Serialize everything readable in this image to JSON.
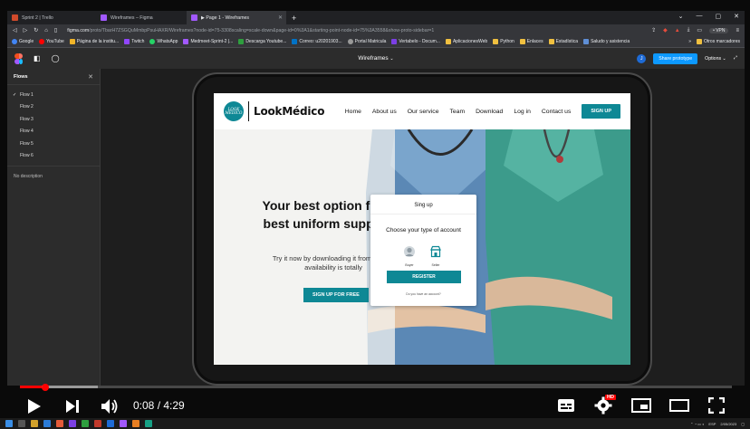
{
  "browser": {
    "tabs": [
      {
        "title": "Sprint 2 | Trello",
        "color": "#d04a2b"
      },
      {
        "title": "Wireframes – Figma",
        "color": "#a259ff"
      },
      {
        "title": "▶ Page 1 - Wireframes",
        "color": "#a259ff",
        "active": true
      }
    ],
    "url_host": "figma.com",
    "url_rest": "/proto/TbarH7ZSGQuMmbpPsuHAXR/Wireframes?node-id=75-3308scaling=scale-down&page-id=0%3A1&starting-point-node-id=75%3A3558&show-proto-sidebar=1",
    "vpn_label": "• VPN",
    "bookmarks": [
      {
        "label": "Google",
        "color": "#4285f4"
      },
      {
        "label": "YouTube",
        "color": "#ff0000"
      },
      {
        "label": "Página de la institu...",
        "color": "#f0b429"
      },
      {
        "label": "Twitch",
        "color": "#9146ff"
      },
      {
        "label": "WhatsApp",
        "color": "#25d366"
      },
      {
        "label": "Medmeet-Sprint-2 |...",
        "color": "#a259ff"
      },
      {
        "label": "Descarga Youtube...",
        "color": "#2e9e3e"
      },
      {
        "label": "Correo: u20201903...",
        "color": "#0072c6"
      },
      {
        "label": "Portal Matricula",
        "color": "#999999"
      },
      {
        "label": "Vertabelo - Docum...",
        "color": "#7b3fe4"
      },
      {
        "label": "AplicacionesWeb",
        "color": "#f0c040"
      },
      {
        "label": "Python",
        "color": "#f0c040"
      },
      {
        "label": "Enlaces",
        "color": "#f0c040"
      },
      {
        "label": "Estadística",
        "color": "#f0c040"
      },
      {
        "label": "Saludo y asistencia",
        "color": "#5f8fd6"
      }
    ],
    "bookmarks_overflow": "»",
    "other_bookmarks": "Otros marcadores"
  },
  "figma": {
    "file_title": "Wireframes",
    "avatar_initial": "J",
    "share_label": "Share prototype",
    "options_label": "Options ⌄",
    "flows_title": "Flows",
    "flows": [
      "Flow 1",
      "Flow 2",
      "Flow 3",
      "Flow 4",
      "Flow 5",
      "Flow 6"
    ],
    "description": "No description"
  },
  "site": {
    "logo_badge": "LOOK MÉDICO",
    "logo_text": "LookMédico",
    "menu": [
      "Home",
      "About us",
      "Our service",
      "Team",
      "Download",
      "Log in",
      "Contact us"
    ],
    "signup_button": "SIGN UP",
    "hero_title": "Your best option f your best uniform suppliers",
    "hero_sub": "Try it now by downloading it from phone, availability is totally",
    "hero_button": "SIGN UP FOR FREE",
    "modal": {
      "title": "Sing up",
      "choose": "Choose your type of account",
      "option_buyer": "Buyer",
      "option_seller": "Seller",
      "register": "REGISTER",
      "have_account": "Do you have an account?"
    }
  },
  "player": {
    "time": "0:08 / 4:29",
    "progress": 0.03,
    "hd_badge": "HD"
  },
  "taskbar": {
    "lang": "ESP",
    "date": "2/05/2023"
  }
}
